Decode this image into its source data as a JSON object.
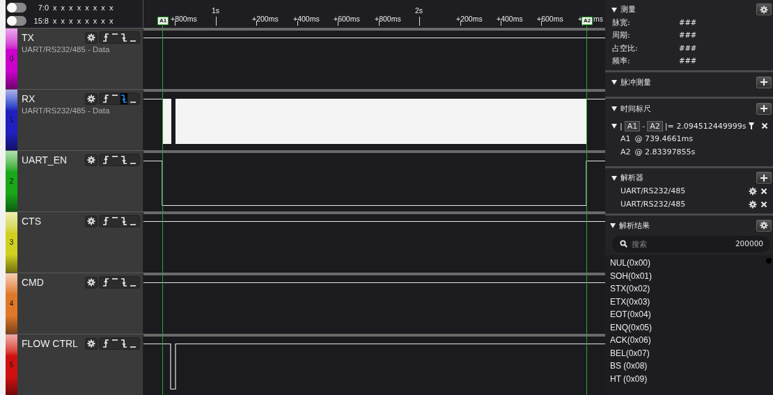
{
  "header": {
    "rows": [
      {
        "switch_on": false,
        "range": "7:0",
        "bits": "x x x x x x x x"
      },
      {
        "switch_on": false,
        "range": "15:8",
        "bits": "x x x x x x x x"
      }
    ]
  },
  "timeline": {
    "ticks": [
      {
        "label": "+800ms",
        "major": false
      },
      {
        "label": "1s",
        "major": true
      },
      {
        "label": "+200ms",
        "major": false
      },
      {
        "label": "+400ms",
        "major": false
      },
      {
        "label": "+600ms",
        "major": false
      },
      {
        "label": "+800ms",
        "major": false
      },
      {
        "label": "2s",
        "major": true
      },
      {
        "label": "+200ms",
        "major": false
      },
      {
        "label": "+400ms",
        "major": false
      },
      {
        "label": "+600ms",
        "major": false
      },
      {
        "label": "+",
        "major": false,
        "tail": "ms"
      }
    ],
    "cursors": [
      {
        "label": "A1"
      },
      {
        "label": "A2"
      }
    ]
  },
  "channels": [
    {
      "index": "0",
      "name": "TX",
      "subtitle": "UART/RS232/485 - Data",
      "color": "#cc00cc",
      "triggers": [
        {
          "selected": false
        },
        {
          "selected": false
        },
        {
          "selected": false
        },
        {
          "selected": false
        }
      ],
      "kind": "idle_high"
    },
    {
      "index": "1",
      "name": "RX",
      "subtitle": "UART/RS232/485 - Data",
      "color": "#2020c0",
      "triggers": [
        {
          "selected": false
        },
        {
          "selected": false
        },
        {
          "selected": true
        },
        {
          "selected": false
        }
      ],
      "kind": "burst"
    },
    {
      "index": "2",
      "name": "UART_EN",
      "color": "#18a818",
      "triggers": [
        {
          "selected": false
        },
        {
          "selected": false
        },
        {
          "selected": false
        },
        {
          "selected": false
        }
      ],
      "kind": "low_window"
    },
    {
      "index": "3",
      "name": "CTS",
      "color": "#d0d020",
      "triggers": [
        {
          "selected": false
        },
        {
          "selected": false
        },
        {
          "selected": false
        },
        {
          "selected": false
        }
      ],
      "kind": "idle_high"
    },
    {
      "index": "4",
      "name": "CMD",
      "color": "#e07828",
      "triggers": [
        {
          "selected": false
        },
        {
          "selected": false
        },
        {
          "selected": false
        },
        {
          "selected": false
        }
      ],
      "kind": "idle_high"
    },
    {
      "index": "5",
      "name": "FLOW CTRL",
      "color": "#d01010",
      "triggers": [
        {
          "selected": false
        },
        {
          "selected": false
        },
        {
          "selected": false
        },
        {
          "selected": false
        }
      ],
      "kind": "pulse_low"
    }
  ],
  "measure": {
    "title": "测量",
    "expanded": true,
    "rows": [
      {
        "label": "脉宽:",
        "value": "###"
      },
      {
        "label": "周期:",
        "value": "###"
      },
      {
        "label": "占空比:",
        "value": "###"
      },
      {
        "label": "频率:",
        "value": "###"
      }
    ]
  },
  "pulse": {
    "title": "脉冲测量",
    "expanded": true
  },
  "ruler": {
    "title": "时间标尺",
    "expanded": true,
    "pair": {
      "expanded": true,
      "open_bar": "|",
      "a": "A1",
      "dash": "-",
      "b": "A2",
      "delta": "|= 2.094512449999s"
    },
    "points": [
      {
        "name": "A1",
        "value": "@ 739.4661ms"
      },
      {
        "name": "A2",
        "value": "@ 2.83397855s"
      }
    ]
  },
  "decoders": {
    "title": "解析器",
    "expanded": true,
    "items": [
      "UART/RS232/485",
      "UART/RS232/485"
    ]
  },
  "results": {
    "title": "解析结果",
    "expanded": true,
    "placeholder": "搜索",
    "count": "200000",
    "items": [
      "NUL(0x00)",
      "SOH(0x01)",
      "STX(0x02)",
      "ETX(0x03)",
      "EOT(0x04)",
      "ENQ(0x05)",
      "ACK(0x06)",
      "BEL(0x07)",
      "BS (0x08)",
      "HT (0x09)"
    ]
  }
}
